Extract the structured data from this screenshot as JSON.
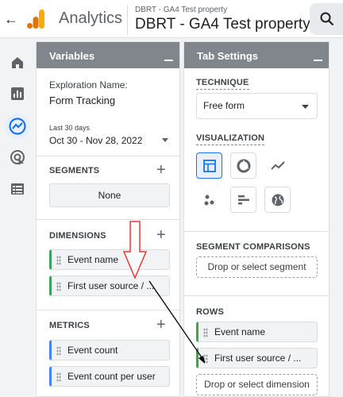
{
  "header": {
    "app_name": "Analytics",
    "property_subtitle": "DBRT - GA4 Test property",
    "property_title": "DBRT - GA4 Test property"
  },
  "rail": {
    "items": [
      {
        "icon": "home-icon"
      },
      {
        "icon": "reports-icon"
      },
      {
        "icon": "explore-icon"
      },
      {
        "icon": "advertising-icon"
      },
      {
        "icon": "configure-icon"
      }
    ]
  },
  "variables": {
    "title": "Variables",
    "exploration_label": "Exploration Name:",
    "exploration_value": "Form Tracking",
    "date_range_label": "Last 30 days",
    "date_range_value": "Oct 30 - Nov 28, 2022",
    "segments_label": "SEGMENTS",
    "segments_value": "None",
    "dimensions_label": "DIMENSIONS",
    "dimensions": [
      "Event name",
      "First user source / ..."
    ],
    "metrics_label": "METRICS",
    "metrics": [
      "Event count",
      "Event count per user"
    ]
  },
  "tab_settings": {
    "title": "Tab Settings",
    "technique_label": "TECHNIQUE",
    "technique_value": "Free form",
    "visualization_label": "VISUALIZATION",
    "visualizations": [
      {
        "icon": "table-icon",
        "selected": true
      },
      {
        "icon": "donut-chart-icon",
        "selected": false
      },
      {
        "icon": "line-chart-icon",
        "selected": false
      },
      {
        "icon": "scatter-plot-icon",
        "selected": false
      },
      {
        "icon": "bar-chart-icon",
        "selected": false
      },
      {
        "icon": "geo-map-icon",
        "selected": false
      }
    ],
    "segment_comparisons_label": "SEGMENT COMPARISONS",
    "segment_drop": "Drop or select segment",
    "rows_label": "ROWS",
    "rows": [
      "Event name",
      "First user source / ..."
    ],
    "dimension_drop": "Drop or select dimension"
  },
  "colors": {
    "panel_header": "#80868b",
    "accent": "#1a73e8",
    "dimension_chip": "#34a853",
    "metric_chip": "#4285f4",
    "annotation_arrow_red": "#e53935"
  }
}
